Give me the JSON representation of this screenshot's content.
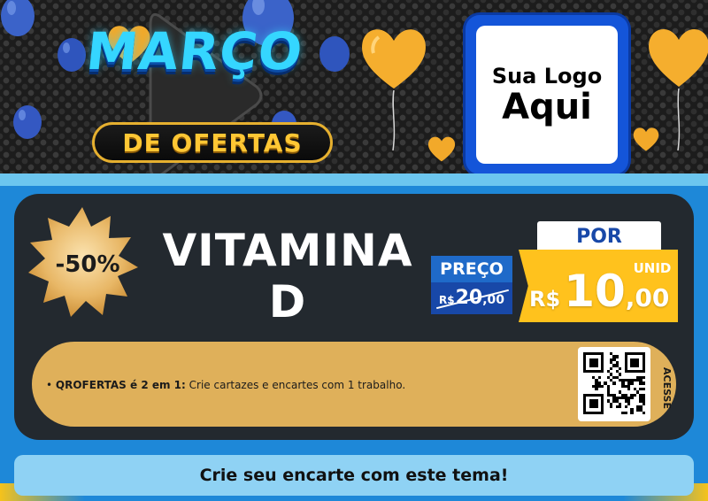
{
  "header": {
    "title_main": "MARÇO",
    "title_sub": "DE OFERTAS",
    "logo_line1": "Sua Logo",
    "logo_line2": "Aqui"
  },
  "product": {
    "discount": "-50%",
    "name_line1": "VITAMINA",
    "name_line2": "D"
  },
  "price": {
    "preco_label": "PREÇO",
    "old_currency": "R$",
    "old_int": "20",
    "old_dec": ",00",
    "por_label": "POR",
    "unit_label": "UNID",
    "new_currency": "R$",
    "new_int": "10",
    "new_dec": ",00"
  },
  "info": {
    "bold": "QROFERTAS é 2 em 1:",
    "text": " Crie cartazes e encartes com 1 trabalho.",
    "qr_label": "ACESSE"
  },
  "cta": {
    "label": "Crie seu encarte com este tema!"
  },
  "colors": {
    "title_cyan": "#35d6ff",
    "ofertas_gold": "#ffc734",
    "panel_dark": "#23292f",
    "price_yellow": "#ffc21d",
    "price_blue": "#1f6ac9",
    "info_band": "#dfb05a",
    "cta_bg": "#8fd2f4"
  }
}
